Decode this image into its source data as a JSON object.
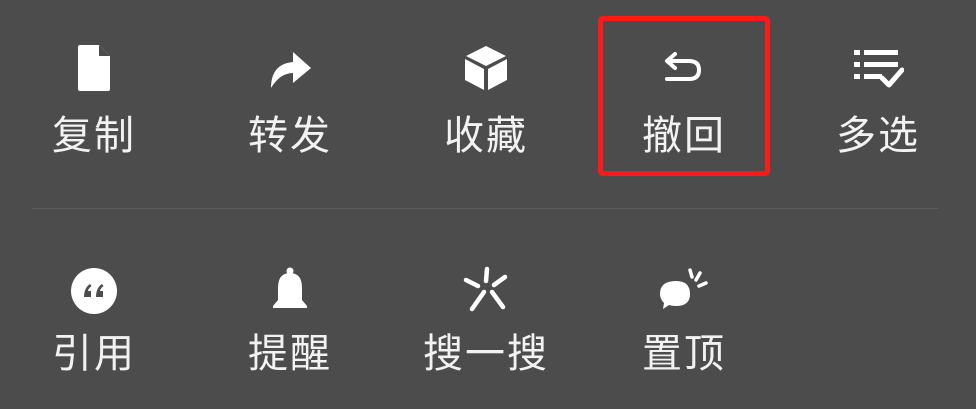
{
  "menu": {
    "row1": [
      {
        "label": "复制",
        "icon": "document-icon"
      },
      {
        "label": "转发",
        "icon": "forward-arrow-icon"
      },
      {
        "label": "收藏",
        "icon": "cube-icon"
      },
      {
        "label": "撤回",
        "icon": "undo-icon"
      },
      {
        "label": "多选",
        "icon": "multi-select-list-icon"
      }
    ],
    "row2": [
      {
        "label": "引用",
        "icon": "quote-icon"
      },
      {
        "label": "提醒",
        "icon": "bell-icon"
      },
      {
        "label": "搜一搜",
        "icon": "search-sparkle-icon"
      },
      {
        "label": "置顶",
        "icon": "pin-top-bubble-icon"
      }
    ]
  },
  "colors": {
    "background": "#4c4c4c",
    "text": "#f2f2f2",
    "icon": "#ffffff",
    "divider": "#5f5f5f",
    "highlight": "#ff1a1a"
  }
}
